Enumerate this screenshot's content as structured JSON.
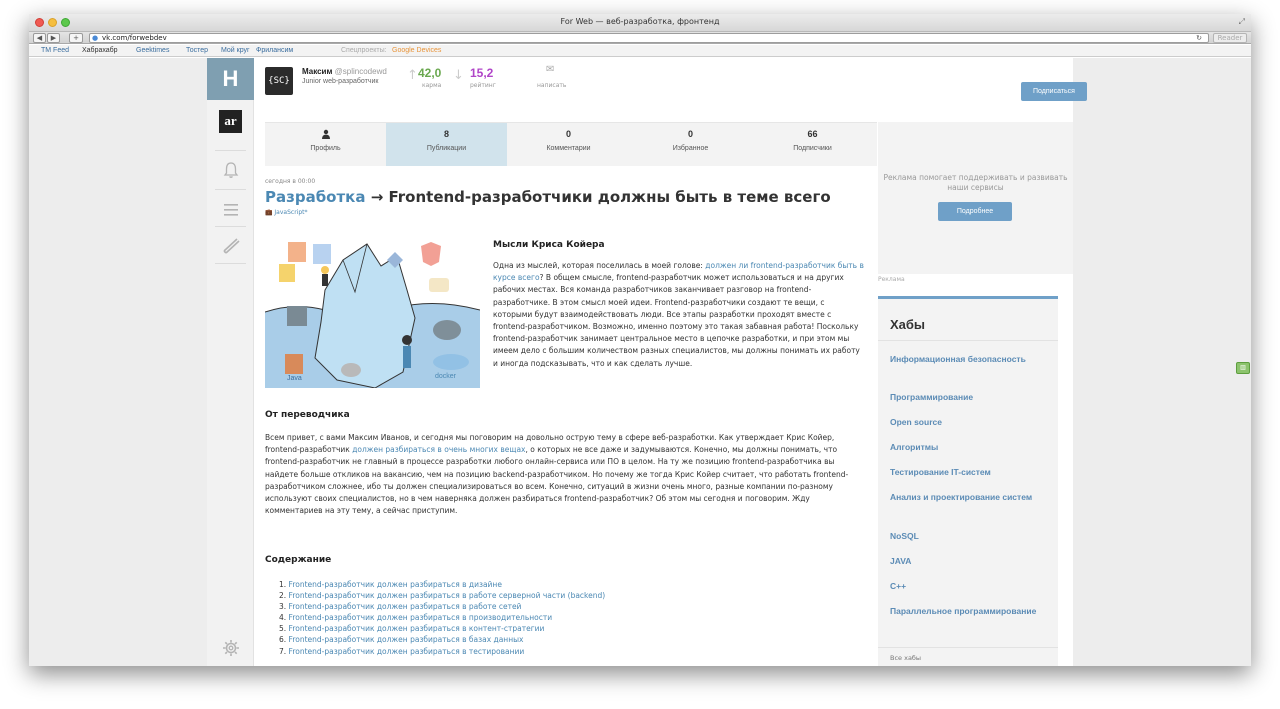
{
  "window": {
    "title": "For Web — веб-разработка, фронтенд"
  },
  "toolbar": {
    "url": "vk.com/forwebdev",
    "reader": "Reader"
  },
  "bookmarks": [
    {
      "label": "TM Feed"
    },
    {
      "label": "Хабрахабр"
    },
    {
      "label": "Geektimes"
    },
    {
      "label": "Тостер"
    },
    {
      "label": "Мой круг"
    },
    {
      "label": "Фрилансим"
    },
    {
      "label": "Спецпроекты:"
    },
    {
      "label": "Google Devices"
    }
  ],
  "rail": {
    "logo": "H",
    "ar": "ar"
  },
  "user": {
    "logo": "{SC}",
    "name": "Максим",
    "nick": "@splincodewd",
    "role": "Junior web-разработчик",
    "karma": "42,0",
    "karma_label": "карма",
    "rating": "15,2",
    "rating_label": "рейтинг",
    "write_label": "написать",
    "subscribe": "Подписаться"
  },
  "tabs": [
    {
      "top": "",
      "label": "Профиль"
    },
    {
      "top": "8",
      "label": "Публикации"
    },
    {
      "top": "0",
      "label": "Комментарии"
    },
    {
      "top": "0",
      "label": "Избранное"
    },
    {
      "top": "66",
      "label": "Подписчики"
    }
  ],
  "article": {
    "date": "сегодня в 00:00",
    "hub": "Разработка",
    "arrow": " → ",
    "title": "Frontend-разработчики должны быть в теме всего",
    "tag": "JavaScript*",
    "h1": "Мысли Криса Койера",
    "p1_a": "Одна из мыслей, которая поселилась в моей голове: ",
    "p1_link": "должен ли frontend-разработчик быть в курсе всего",
    "p1_b": "? В общем смысле, frontend-разработчик может использоваться и на других рабочих местах. Вся команда разработчиков заканчивает разговор на frontend-разработчике. В этом смысл моей идеи. Frontend-разработчики создают те вещи, с которыми будут взаимодействовать люди. Все этапы разработки проходят вместе с frontend-разработчиком. Возможно, именно поэтому это такая забавная работа! Поскольку frontend-разработчик занимает центральное место в цепочке разработки, и при этом мы имеем дело с большим количеством разных специалистов, мы должны понимать их работу и иногда подсказывать, что и как сделать лучше.",
    "h2": "От переводчика",
    "p2_a": "Всем привет, с вами Максим Иванов, и сегодня мы поговорим на довольно острую тему в сфере веб-разработки. Как утверждает Крис Койер, frontend-разработчик ",
    "p2_link": "должен разбираться в очень многих вещах",
    "p2_b": ", о которых не все даже и задумываются. Конечно, мы должны понимать, что frontend-разработчик не главный в процессе разработки любого онлайн-сервиса или ПО в целом. На ту же позицию frontend-разработчика вы найдете больше откликов на вакансию, чем на позицию backend-разработчиком. Но почему же тогда Крис Койер считает, что работать frontend-разработчиком сложнее, ибо ты должен специализироваться во всем. Конечно, ситуаций в жизни очень много, разные компании по-разному используют своих специалистов, но в чем наверняка должен разбираться frontend-разработчик? Об этом мы сегодня и поговорим. Жду комментариев на эту тему, а сейчас приступим.",
    "h3": "Содержание",
    "toc": [
      "Frontend-разработчик должен разбираться в дизайне",
      "Frontend-разработчик должен разбираться в работе серверной части (backend)",
      "Frontend-разработчик должен разбираться в работе сетей",
      "Frontend-разработчик должен разбираться в производительности",
      "Frontend-разработчик должен разбираться в контент-стратегии",
      "Frontend-разработчик должен разбираться в базах данных",
      "Frontend-разработчик должен разбираться в тестировании"
    ]
  },
  "illustration": {
    "java": "Java",
    "docker": "docker"
  },
  "ad": {
    "text": "Реклама помогает поддерживать и развивать наши сервисы",
    "button": "Подробнее",
    "label": "Реклама"
  },
  "hubs": {
    "title": "Хабы",
    "items": [
      "Информационная безопасность",
      "Программирование",
      "Open source",
      "Алгоритмы",
      "Тестирование IT-систем",
      "Анализ и проектирование систем",
      "NoSQL",
      "JAVA",
      "C++",
      "Параллельное программирование"
    ],
    "all": "Все хабы"
  },
  "colors": {
    "accent": "#6fa0c8",
    "link": "#4b88b3",
    "karma": "#6aa84f",
    "rating": "#b045c8",
    "rail_logo": "#7f9fb1"
  }
}
